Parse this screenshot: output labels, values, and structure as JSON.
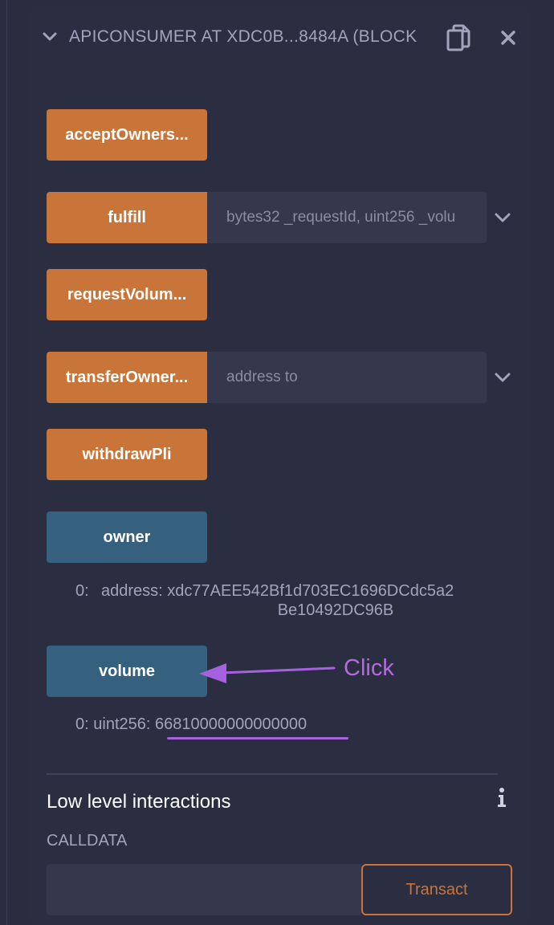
{
  "panel": {
    "title": "APICONSUMER AT XDC0B...8484A (BLOCK",
    "copy_icon": "copy-icon",
    "close_icon": "close-icon"
  },
  "functions": [
    {
      "label": "acceptOwners...",
      "kind": "transact"
    },
    {
      "label": "fulfill",
      "kind": "transact",
      "param_placeholder": "bytes32 _requestId, uint256 _volu"
    },
    {
      "label": "requestVolum...",
      "kind": "transact"
    },
    {
      "label": "transferOwner...",
      "kind": "transact",
      "param_placeholder": "address to"
    },
    {
      "label": "withdrawPli",
      "kind": "transact"
    },
    {
      "label": "owner",
      "kind": "call"
    },
    {
      "label": "volume",
      "kind": "call"
    }
  ],
  "results": {
    "owner": {
      "index": "0:",
      "value_line1": "address: xdc77AEE542Bf1d703EC1696DCdc5a2",
      "value_line2": "Be10492DC96B"
    },
    "volume": {
      "index": "0:",
      "type": "uint256:",
      "value": "66810000000000000"
    }
  },
  "annotation": {
    "label": "Click",
    "color": "#b56be0"
  },
  "low_level": {
    "title": "Low level interactions",
    "calldata_label": "CALLDATA",
    "calldata_value": "",
    "transact_label": "Transact"
  },
  "colors": {
    "background": "#2a2c3f",
    "orange_button": "#c97539",
    "blue_button": "#35607e",
    "input_bg": "#35384c",
    "muted_text": "#a2a3bd"
  }
}
